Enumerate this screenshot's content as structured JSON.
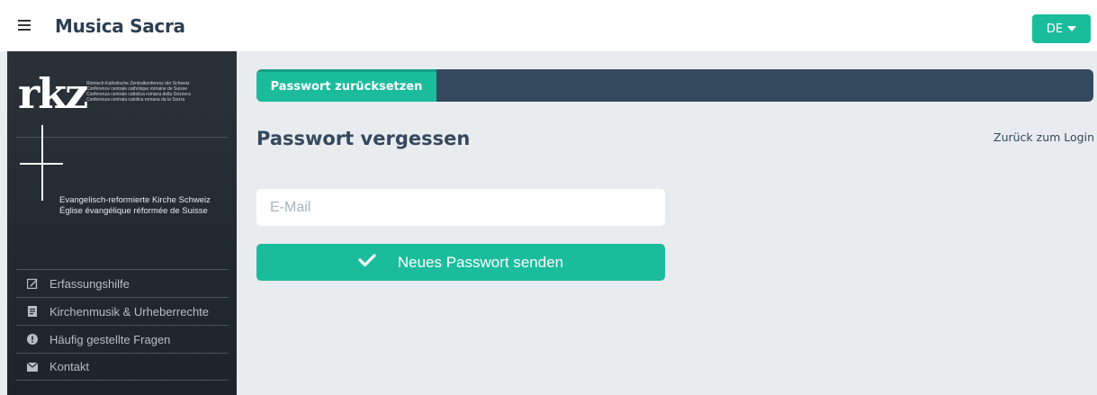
{
  "header": {
    "title": "Musica Sacra",
    "language": "DE",
    "accent_color": "#1abc9c"
  },
  "sidebar": {
    "rkz_logo": "rkz",
    "rkz_lines": [
      "Römisch-Katholische Zentralkonferenz der Schweiz",
      "Conférence centrale catholique romaine de Suisse",
      "Conferenza centrale cattolica romana della Svizzera",
      "Conferenza centrala catolica romana da la Svizra"
    ],
    "ref_lines": [
      "Evangelisch-reformierte Kirche Schweiz",
      "Église évangélique réformée de Suisse"
    ],
    "items": [
      {
        "label": "Erfassungshilfe",
        "icon": "edit-icon"
      },
      {
        "label": "Kirchenmusik & Urheberrechte",
        "icon": "document-icon"
      },
      {
        "label": "Häufig gestellte Fragen",
        "icon": "info-icon"
      },
      {
        "label": "Kontakt",
        "icon": "envelope-icon"
      }
    ]
  },
  "main": {
    "tab_label": "Passwort zurücksetzen",
    "page_title": "Passwort vergessen",
    "back_link": "Zurück zum Login",
    "email_placeholder": "E-Mail",
    "submit_label": "Neues Passwort senden"
  }
}
